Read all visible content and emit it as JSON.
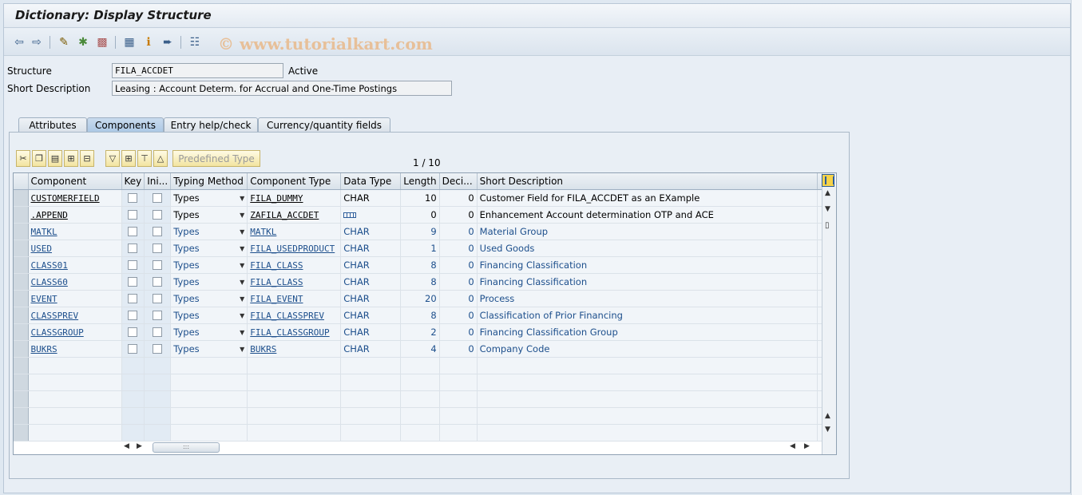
{
  "title": "Dictionary: Display Structure",
  "watermark": "© www.tutorialkart.com",
  "header": {
    "structure_label": "Structure",
    "structure_value": "FILA_ACCDET",
    "status": "Active",
    "short_desc_label": "Short Description",
    "short_desc_value": "Leasing : Account Determ. for Accrual and One-Time Postings"
  },
  "tabs": [
    {
      "label": "Attributes"
    },
    {
      "label": "Components"
    },
    {
      "label": "Entry help/check"
    },
    {
      "label": "Currency/quantity fields"
    }
  ],
  "grid_toolbar": {
    "predefined_type_label": "Predefined Type",
    "pager": "1  /  10"
  },
  "columns": [
    "Component",
    "Key",
    "Ini...",
    "Typing Method",
    "Component Type",
    "Data Type",
    "Length",
    "Deci...",
    "Short Description"
  ],
  "rows": [
    {
      "component": "CUSTOMERFIELD",
      "typing": "Types",
      "comp_type": "FILA_DUMMY",
      "data_type": "CHAR",
      "length": "10",
      "dec": "0",
      "desc": "Customer Field for FILA_ACCDET as an  EXample"
    },
    {
      "component": ".APPEND",
      "typing": "Types",
      "comp_type": "ZAFILA_ACCDET",
      "data_type": "",
      "length": "0",
      "dec": "0",
      "desc": "Enhancement Account determination OTP and ACE"
    },
    {
      "component": "MATKL",
      "typing": "Types",
      "comp_type": "MATKL",
      "data_type": "CHAR",
      "length": "9",
      "dec": "0",
      "desc": "Material Group"
    },
    {
      "component": "USED",
      "typing": "Types",
      "comp_type": "FILA_USEDPRODUCT",
      "data_type": "CHAR",
      "length": "1",
      "dec": "0",
      "desc": "Used Goods"
    },
    {
      "component": "CLASS01",
      "typing": "Types",
      "comp_type": "FILA_CLASS",
      "data_type": "CHAR",
      "length": "8",
      "dec": "0",
      "desc": "Financing Classification"
    },
    {
      "component": "CLASS60",
      "typing": "Types",
      "comp_type": "FILA_CLASS",
      "data_type": "CHAR",
      "length": "8",
      "dec": "0",
      "desc": "Financing Classification"
    },
    {
      "component": "EVENT",
      "typing": "Types",
      "comp_type": "FILA_EVENT",
      "data_type": "CHAR",
      "length": "20",
      "dec": "0",
      "desc": "Process"
    },
    {
      "component": "CLASSPREV",
      "typing": "Types",
      "comp_type": "FILA_CLASSPREV",
      "data_type": "CHAR",
      "length": "8",
      "dec": "0",
      "desc": "Classification of Prior Financing"
    },
    {
      "component": "CLASSGROUP",
      "typing": "Types",
      "comp_type": "FILA_CLASSGROUP",
      "data_type": "CHAR",
      "length": "2",
      "dec": "0",
      "desc": "Financing Classification Group"
    },
    {
      "component": "BUKRS",
      "typing": "Types",
      "comp_type": "BUKRS",
      "data_type": "CHAR",
      "length": "4",
      "dec": "0",
      "desc": "Company Code"
    }
  ],
  "icons": {
    "toolbar": [
      "back-arrow-icon",
      "forward-arrow-icon",
      "edit-pen-icon",
      "activate-icon",
      "object-list-icon",
      "hierarchy-icon",
      "info-icon",
      "navigate-icon",
      "tree-icon"
    ],
    "grid": [
      "cut-icon",
      "copy-icon",
      "paste-icon",
      "insert-row-icon",
      "delete-row-icon",
      "sort-icon",
      "expand-icon",
      "first-row-icon",
      "last-row-icon",
      "column-settings-icon"
    ]
  }
}
